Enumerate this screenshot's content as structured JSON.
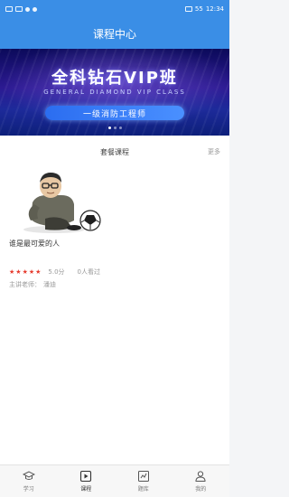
{
  "status": {
    "battery": "55",
    "time": "12:34"
  },
  "header": {
    "title": "课程中心"
  },
  "banner": {
    "title": "全科钻石VIP班",
    "subtitle": "GENERAL DIAMOND VIP CLASS",
    "pill": "一级消防工程师"
  },
  "section": {
    "title": "套餐课程",
    "more": "更多"
  },
  "course": {
    "name": "谁是最可爱的人",
    "stars": 5,
    "score": "5.0分",
    "learners": "0人看过",
    "teacher_label": "主讲老师：",
    "teacher_name": "潘迪"
  },
  "tabs": [
    {
      "label": "学习",
      "icon": "graduation-cap-icon"
    },
    {
      "label": "课程",
      "icon": "play-icon"
    },
    {
      "label": "题库",
      "icon": "question-bank-icon"
    },
    {
      "label": "我的",
      "icon": "user-icon"
    }
  ],
  "colors": {
    "primary": "#3a8ee6",
    "star": "#e63b2e"
  }
}
